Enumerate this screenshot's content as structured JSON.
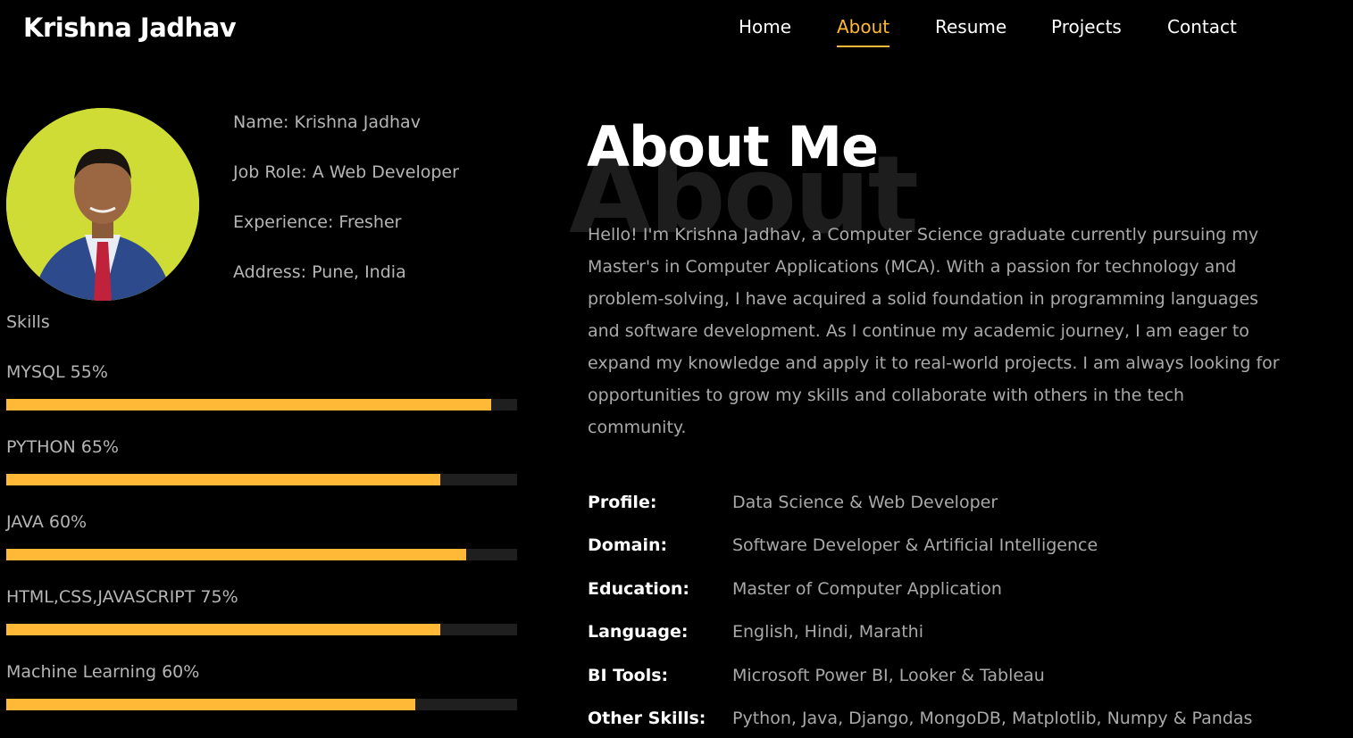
{
  "brand": "Krishna Jadhav",
  "nav": {
    "items": [
      "Home",
      "About",
      "Resume",
      "Projects",
      "Contact"
    ],
    "active": "About",
    "accent": "#ffb937"
  },
  "profile": {
    "name": "Name: Krishna Jadhav",
    "job_role": "Job Role: A Web Developer",
    "experience": "Experience: Fresher",
    "address": "Address: Pune, India"
  },
  "skills": {
    "title": "Skills",
    "items": [
      {
        "label": "MYSQL 55%",
        "fill": 0.95
      },
      {
        "label": "PYTHON 65%",
        "fill": 0.85
      },
      {
        "label": "JAVA 60%",
        "fill": 0.9
      },
      {
        "label": "HTML,CSS,JAVASCRIPT 75%",
        "fill": 0.85
      },
      {
        "label": "Machine Learning 60%",
        "fill": 0.8
      }
    ]
  },
  "about": {
    "bg_word": "About",
    "title": "About Me",
    "paragraph": "Hello! I'm Krishna Jadhav, a Computer Science graduate currently pursuing my Master's in Computer Applications (MCA). With a passion for technology and problem-solving, I have acquired a solid foundation in programming languages and software development. As I continue my academic journey, I am eager to expand my knowledge and apply it to real-world projects. I am always looking for opportunities to grow my skills and collaborate with others in the tech community."
  },
  "details": [
    {
      "key": "Profile:",
      "value": "Data Science & Web Developer"
    },
    {
      "key": "Domain:",
      "value": "Software Developer & Artificial Intelligence"
    },
    {
      "key": "Education:",
      "value": "Master of Computer Application"
    },
    {
      "key": "Language:",
      "value": "English, Hindi, Marathi"
    },
    {
      "key": "BI Tools:",
      "value": "Microsoft Power BI, Looker & Tableau"
    },
    {
      "key": "Other Skills:",
      "value": "Python, Java, Django, MongoDB, Matplotlib, Numpy & Pandas"
    }
  ]
}
